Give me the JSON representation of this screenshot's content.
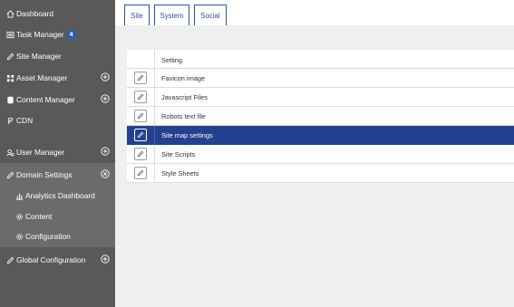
{
  "sidebar": {
    "items": [
      {
        "label": "Dashboard",
        "icon": "home-icon"
      },
      {
        "label": "Task Manager",
        "icon": "tasks-icon",
        "badge": "4"
      },
      {
        "label": "Site Manager",
        "icon": "pencil-icon"
      },
      {
        "label": "Asset Manager",
        "icon": "grid-icon",
        "expand": "plus"
      },
      {
        "label": "Content Manager",
        "icon": "database-icon",
        "expand": "plus"
      },
      {
        "label": "CDN",
        "icon": "cdn-icon"
      },
      {
        "label": "User Manager",
        "icon": "users-icon",
        "expand": "plus"
      },
      {
        "label": "Domain Settings",
        "icon": "pencil-icon",
        "expand": "close"
      },
      {
        "label": "Analytics Dashboard",
        "icon": "chart-icon"
      },
      {
        "label": "Content",
        "icon": "gear-icon"
      },
      {
        "label": "Configuration",
        "icon": "gear-icon"
      },
      {
        "label": "Global Configuration",
        "icon": "pencil-icon",
        "expand": "plus"
      }
    ]
  },
  "tabs": [
    {
      "label": "Site",
      "active": true
    },
    {
      "label": "System",
      "active": false
    },
    {
      "label": "Social",
      "active": false
    }
  ],
  "grid": {
    "header": "Setting",
    "rows": [
      {
        "label": "Favicon image",
        "selected": false
      },
      {
        "label": "Javascript Files",
        "selected": false
      },
      {
        "label": "Robots text file",
        "selected": false
      },
      {
        "label": "Site map settings",
        "selected": true
      },
      {
        "label": "Site Scripts",
        "selected": false
      },
      {
        "label": "Style Sheets",
        "selected": false
      }
    ]
  },
  "colors": {
    "sidebar_bg": "#595959",
    "sidebar_expanded_bg": "#6b6b6b",
    "accent": "#24418f",
    "tab_border": "#2b4fa8",
    "badge": "#1f5fbf",
    "content_bg": "#efefef"
  }
}
